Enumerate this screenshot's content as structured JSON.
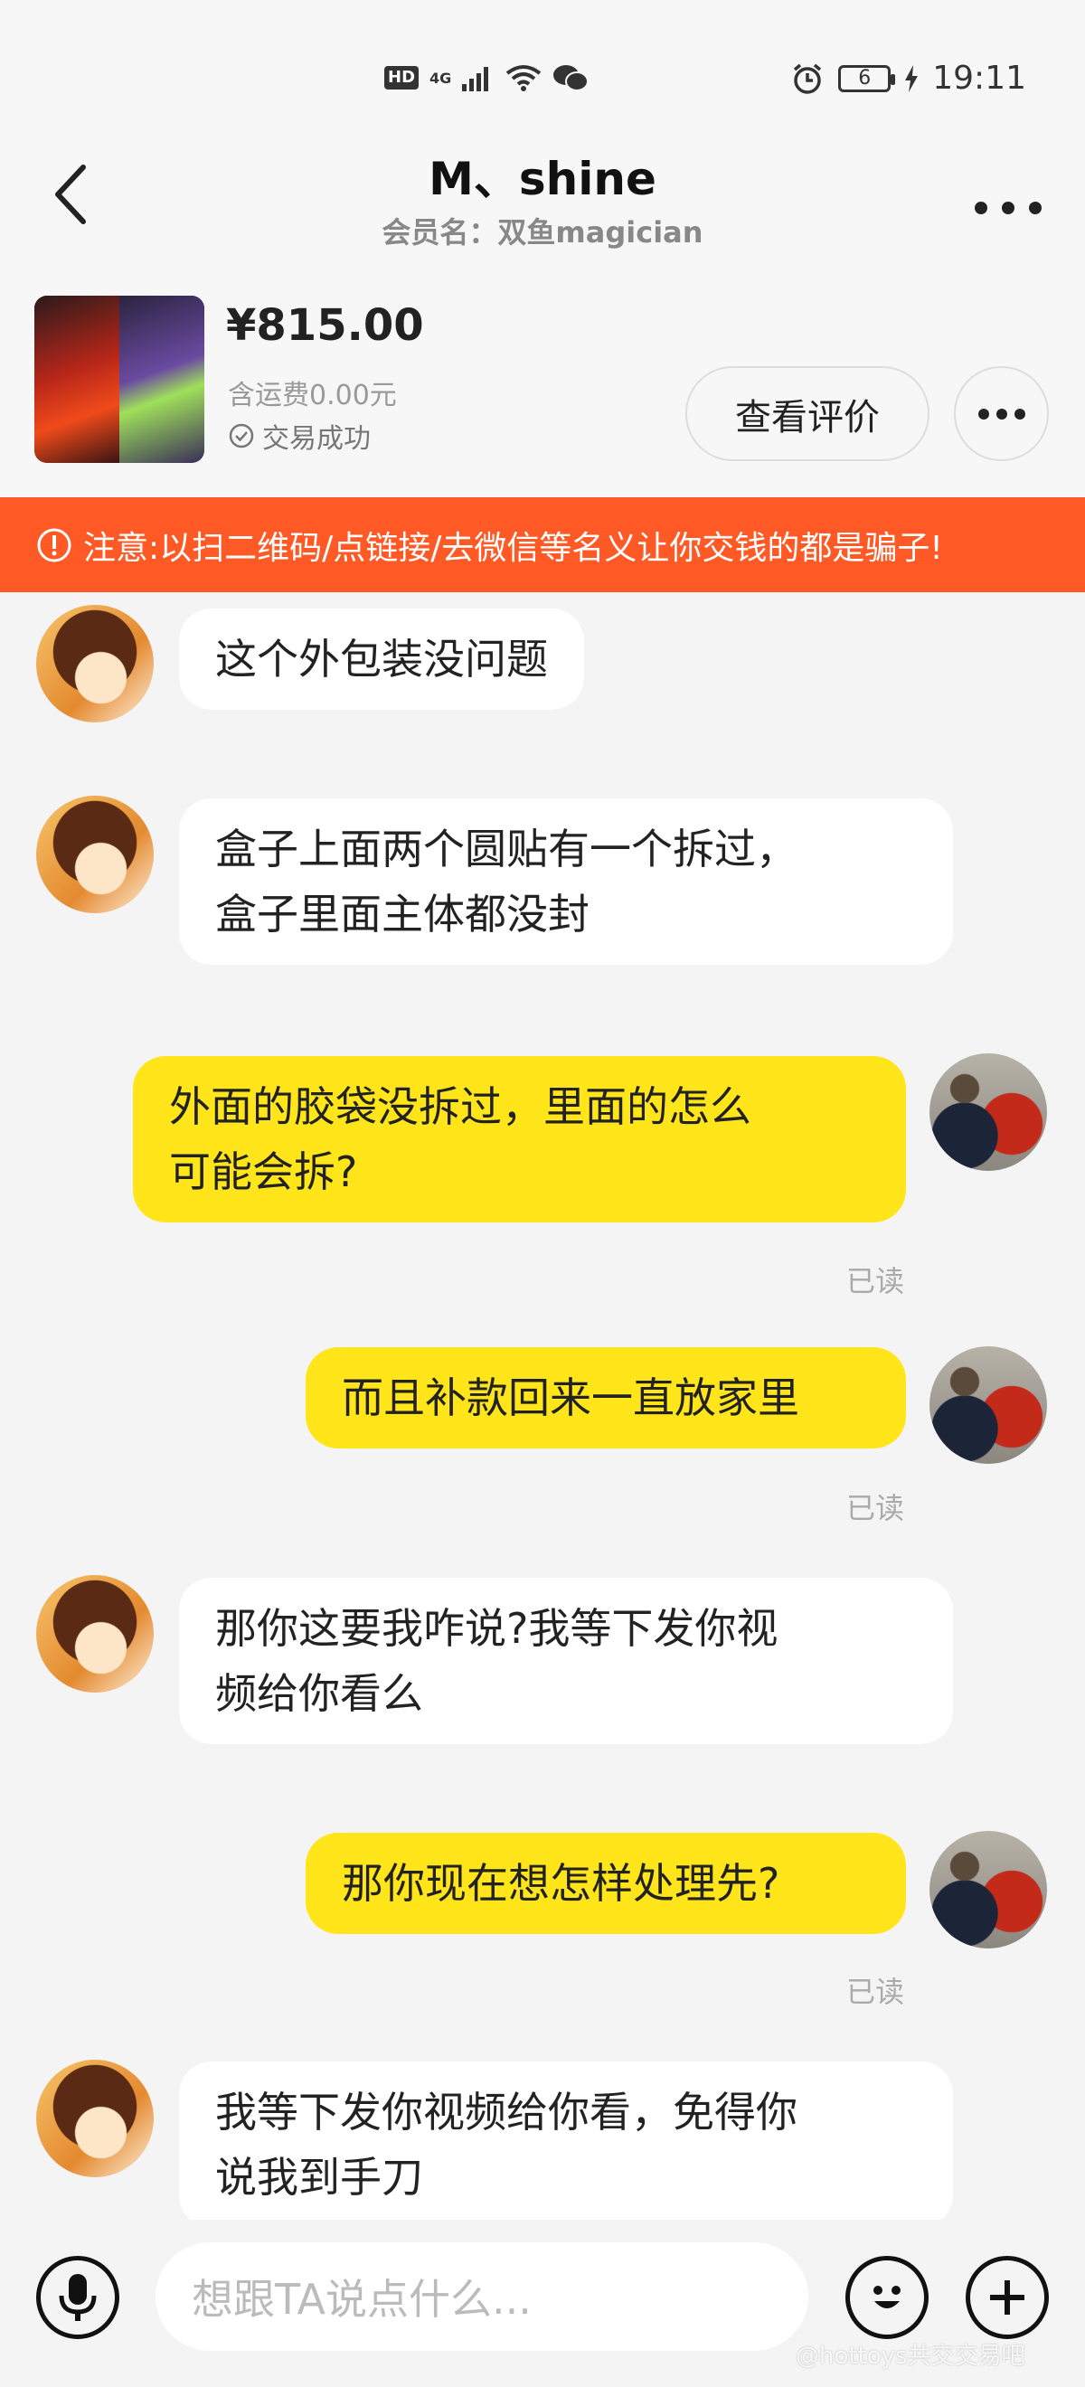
{
  "status_bar": {
    "hd": "HD",
    "signal": "4G",
    "battery": "6",
    "time": "19:11"
  },
  "header": {
    "title": "M、shine",
    "subtitle": "会员名：双鱼magician"
  },
  "product": {
    "price": "¥815.00",
    "shipping": "含运费0.00元",
    "status": "交易成功",
    "review_button": "查看评价"
  },
  "warning": {
    "text": "注意:以扫二维码/点链接/去微信等名义让你交钱的都是骗子!"
  },
  "messages": [
    {
      "from": "other",
      "lines": [
        "这个外包装没问题"
      ]
    },
    {
      "from": "other",
      "lines": [
        "盒子上面两个圆贴有一个拆过，",
        "盒子里面主体都没封"
      ]
    },
    {
      "from": "self",
      "lines": [
        "外面的胶袋没拆过，里面的怎么",
        "可能会拆?"
      ],
      "read": "已读"
    },
    {
      "from": "self",
      "lines": [
        "而且补款回来一直放家里"
      ],
      "read": "已读"
    },
    {
      "from": "other",
      "lines": [
        "那你这要我咋说?我等下发你视",
        "频给你看么"
      ]
    },
    {
      "from": "self",
      "lines": [
        "那你现在想怎样处理先?"
      ],
      "read": "已读"
    },
    {
      "from": "other",
      "lines": [
        "我等下发你视频给你看，免得你",
        "说我到手刀"
      ]
    }
  ],
  "input": {
    "placeholder": "想跟TA说点什么..."
  },
  "watermark": "@hottoys共交交易吧"
}
